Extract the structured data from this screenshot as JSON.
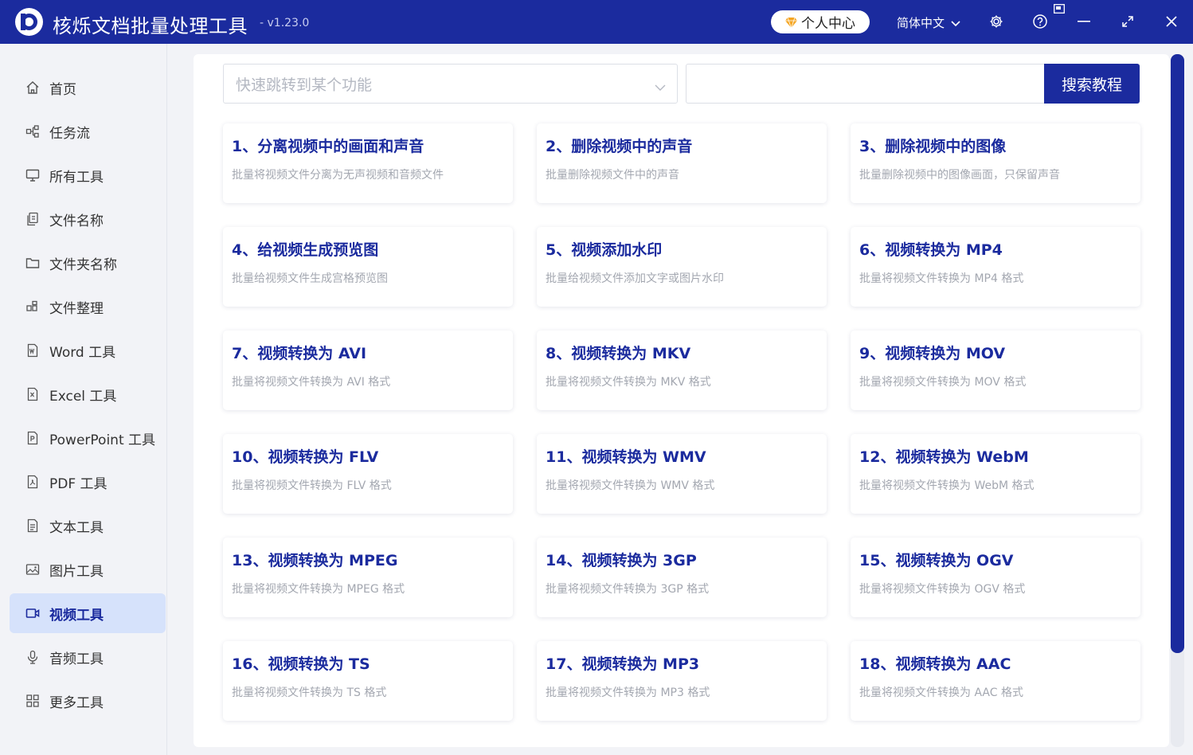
{
  "app": {
    "title": "核烁文档批量处理工具",
    "version": "- v1.23.0",
    "user_center": "个人中心",
    "language": "简体中文"
  },
  "colors": {
    "brand": "#1b2b9e",
    "active_bg": "#d6e2fb"
  },
  "sidebar": {
    "items": [
      {
        "label": "首页",
        "icon": "home-icon"
      },
      {
        "label": "任务流",
        "icon": "workflow-icon"
      },
      {
        "label": "所有工具",
        "icon": "monitor-icon"
      },
      {
        "label": "文件名称",
        "icon": "file-copy-icon"
      },
      {
        "label": "文件夹名称",
        "icon": "folder-icon"
      },
      {
        "label": "文件整理",
        "icon": "organize-icon"
      },
      {
        "label": "Word 工具",
        "icon": "word-file-icon"
      },
      {
        "label": "Excel 工具",
        "icon": "excel-file-icon"
      },
      {
        "label": "PowerPoint 工具",
        "icon": "ppt-file-icon"
      },
      {
        "label": "PDF 工具",
        "icon": "pdf-file-icon"
      },
      {
        "label": "文本工具",
        "icon": "text-file-icon"
      },
      {
        "label": "图片工具",
        "icon": "image-icon"
      },
      {
        "label": "视频工具",
        "icon": "video-icon",
        "active": true
      },
      {
        "label": "音频工具",
        "icon": "microphone-icon"
      },
      {
        "label": "更多工具",
        "icon": "grid-icon"
      }
    ]
  },
  "search": {
    "jump_placeholder": "快速跳转到某个功能",
    "input_placeholder": "",
    "button_label": "搜索教程"
  },
  "tools": [
    {
      "title": "1、分离视频中的画面和声音",
      "desc": "批量将视频文件分离为无声视频和音频文件"
    },
    {
      "title": "2、删除视频中的声音",
      "desc": "批量删除视频文件中的声音"
    },
    {
      "title": "3、删除视频中的图像",
      "desc": "批量删除视频中的图像画面，只保留声音"
    },
    {
      "title": "4、给视频生成预览图",
      "desc": "批量给视频文件生成宫格预览图"
    },
    {
      "title": "5、视频添加水印",
      "desc": "批量给视频文件添加文字或图片水印"
    },
    {
      "title": "6、视频转换为 MP4",
      "desc": "批量将视频文件转换为 MP4 格式"
    },
    {
      "title": "7、视频转换为 AVI",
      "desc": "批量将视频文件转换为 AVI 格式"
    },
    {
      "title": "8、视频转换为 MKV",
      "desc": "批量将视频文件转换为 MKV 格式"
    },
    {
      "title": "9、视频转换为 MOV",
      "desc": "批量将视频文件转换为 MOV 格式"
    },
    {
      "title": "10、视频转换为 FLV",
      "desc": "批量将视频文件转换为 FLV 格式"
    },
    {
      "title": "11、视频转换为 WMV",
      "desc": "批量将视频文件转换为 WMV 格式"
    },
    {
      "title": "12、视频转换为 WebM",
      "desc": "批量将视频文件转换为 WebM 格式"
    },
    {
      "title": "13、视频转换为 MPEG",
      "desc": "批量将视频文件转换为 MPEG 格式"
    },
    {
      "title": "14、视频转换为 3GP",
      "desc": "批量将视频文件转换为 3GP 格式"
    },
    {
      "title": "15、视频转换为 OGV",
      "desc": "批量将视频文件转换为 OGV 格式"
    },
    {
      "title": "16、视频转换为 TS",
      "desc": "批量将视频文件转换为 TS 格式"
    },
    {
      "title": "17、视频转换为 MP3",
      "desc": "批量将视频文件转换为 MP3 格式"
    },
    {
      "title": "18、视频转换为 AAC",
      "desc": "批量将视频文件转换为 AAC 格式"
    }
  ]
}
